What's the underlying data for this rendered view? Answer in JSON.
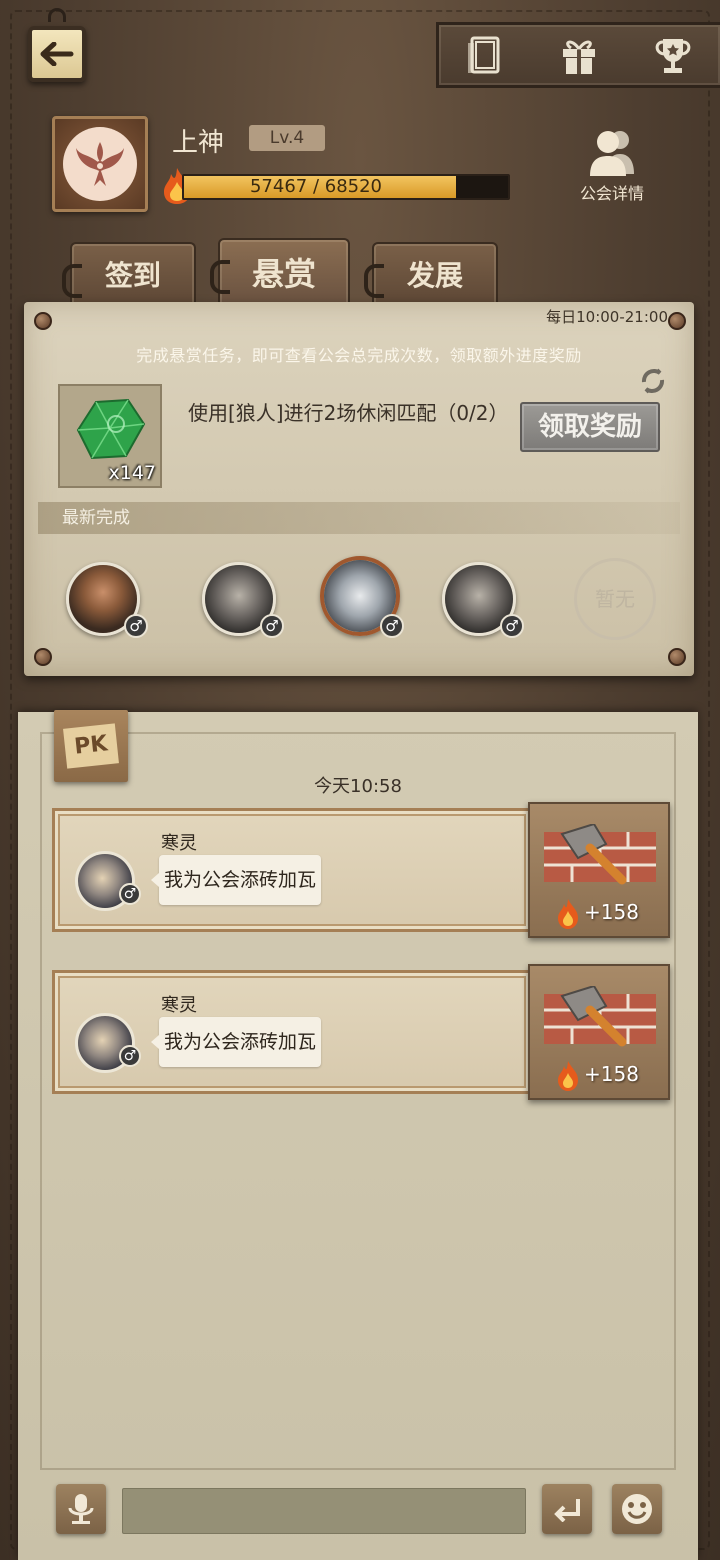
{
  "header": {
    "back_icon": "back-arrow-icon",
    "top_icons": [
      {
        "name": "cards-icon"
      },
      {
        "name": "gift-icon"
      },
      {
        "name": "trophy-icon"
      }
    ]
  },
  "guild": {
    "name": "上神",
    "level": "Lv.4",
    "xp_current": 57467,
    "xp_max": 68520,
    "xp_text": "57467 / 68520",
    "details_label": "公会详情"
  },
  "tabs": [
    {
      "label": "签到",
      "active": false
    },
    {
      "label": "悬赏",
      "active": true
    },
    {
      "label": "发展",
      "active": false
    }
  ],
  "bounty": {
    "time_window": "每日10:00-21:00",
    "description": "完成悬赏任务，即可查看公会总完成次数，领取额外进度奖励",
    "reward_count": "x147",
    "task_text": "使用[狼人]进行2场休闲匹配（0/2）",
    "claim_label": "领取奖励",
    "latest_label": "最新完成",
    "none_label": "暂无",
    "gender_symbol": "♂"
  },
  "feed": {
    "time": "今天10:58",
    "messages": [
      {
        "name": "寒灵",
        "text": "我为公会添砖加瓦",
        "points": "+158"
      },
      {
        "name": "寒灵",
        "text": "我为公会添砖加瓦",
        "points": "+158"
      }
    ]
  },
  "input": {
    "placeholder": ""
  },
  "colors": {
    "xp_fill": "#e0a52e",
    "panel_bg": "#d6cdb6",
    "wood_dark": "#4a3a2c"
  }
}
